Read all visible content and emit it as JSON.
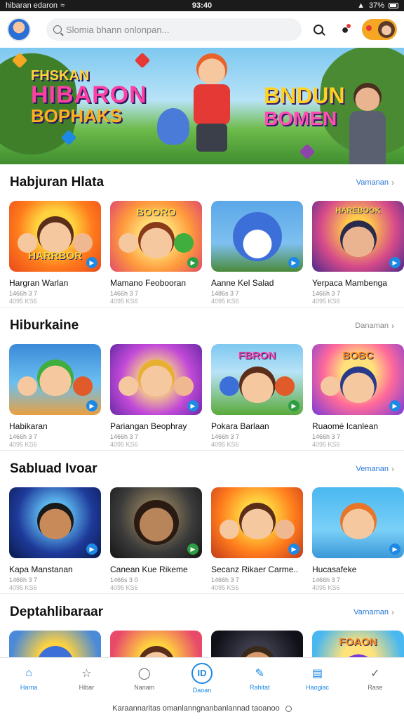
{
  "status_bar": {
    "carrier": "hibaran edaron",
    "time": "93:40",
    "battery": "37%"
  },
  "header": {
    "search_placeholder": "Slomia bhann onlonpan..."
  },
  "banner": {
    "left_line1": "FHSKAN",
    "left_line2": "HIBARON",
    "left_line3": "BOPHAKS",
    "right_line1": "BNDUN",
    "right_line2": "BOMEN"
  },
  "sections": [
    {
      "title": "Habjuran Hlata",
      "view_all": "Vamanan",
      "cards": [
        {
          "title": "Hargran Warlan",
          "meta1": "1466h 3 7",
          "meta2": "4095 KS6",
          "badge_color": "#1e88e5",
          "word": "HARRBOR"
        },
        {
          "title": "Mamano Feobooran",
          "meta1": "1466h 3 7",
          "meta2": "4095 KS6",
          "badge_color": "#1e88e5",
          "word": "BOORO"
        },
        {
          "title": "Aanne Kel Salad",
          "meta1": "1486s 3 7",
          "meta2": "4095 KS6",
          "badge_color": "#1e88e5",
          "word": ""
        },
        {
          "title": "Yerpaca Mambenga",
          "meta1": "1466h 3 7",
          "meta2": "4095 KS6",
          "badge_color": "#1e88e5",
          "word": "HAREBOOK"
        }
      ]
    },
    {
      "title": "Hiburkaine",
      "view_all": "Danaman",
      "cards": [
        {
          "title": "Habikaran",
          "meta1": "1466h 3 7",
          "meta2": "4095 KS6",
          "badge_color": "#1e88e5",
          "word": ""
        },
        {
          "title": "Pariangan Beophray",
          "meta1": "1466h 3 7",
          "meta2": "4095 KS6",
          "badge_color": "#1e88e5",
          "word": ""
        },
        {
          "title": "Pokara Barlaan",
          "meta1": "1466h 3 7",
          "meta2": "4095 KS6",
          "badge_color": "#1e88e5",
          "word": "FBRON"
        },
        {
          "title": "Ruaomé Icanlean",
          "meta1": "1466h 3 7",
          "meta2": "4095 KS6",
          "badge_color": "#1e88e5",
          "word": "BOBC"
        }
      ]
    },
    {
      "title": "Sabluad Ivoar",
      "view_all": "Vemanan",
      "cards": [
        {
          "title": "Kapa Manstanan",
          "meta1": "1466h 3 7",
          "meta2": "4095 KS6",
          "badge_color": "#1e88e5",
          "word": ""
        },
        {
          "title": "Canean Kue Rikeme",
          "meta1": "1466s 3 0",
          "meta2": "4095 KS6",
          "badge_color": "#2e9e44",
          "word": ""
        },
        {
          "title": "Secanz Rikaer Carme..",
          "meta1": "1466h 3 7",
          "meta2": "4095 KS6",
          "badge_color": "#1e88e5",
          "word": ""
        },
        {
          "title": "Hucasafeke",
          "meta1": "1466h 3 7",
          "meta2": "4095 KS6",
          "badge_color": "#1e88e5",
          "word": ""
        }
      ]
    },
    {
      "title": "Deptahlibaraar",
      "view_all": "Varnaman",
      "cards": [
        {
          "title": "",
          "meta1": "",
          "meta2": "",
          "badge_color": "#1e88e5",
          "word": ""
        },
        {
          "title": "",
          "meta1": "",
          "meta2": "",
          "badge_color": "#1e88e5",
          "word": ""
        },
        {
          "title": "",
          "meta1": "",
          "meta2": "",
          "badge_color": "#1e88e5",
          "word": ""
        },
        {
          "title": "",
          "meta1": "",
          "meta2": "",
          "badge_color": "#1e88e5",
          "word": "FOAON"
        }
      ]
    }
  ],
  "nav": [
    {
      "label": "Harna",
      "icon": "home-icon",
      "active": true
    },
    {
      "label": "Hibar",
      "icon": "star-icon",
      "active": false
    },
    {
      "label": "Nanam",
      "icon": "chat-icon",
      "active": false
    },
    {
      "label": "Daoan",
      "icon": "center-icon",
      "active": true,
      "center_text": "ID"
    },
    {
      "label": "Rahitat",
      "icon": "edit-icon",
      "active": true
    },
    {
      "label": "Haogiac",
      "icon": "book-icon",
      "active": true
    },
    {
      "label": "Rase",
      "icon": "check-icon",
      "active": false
    }
  ],
  "footer_text": "Karaannaritas omanlanngnanbanlannad taoanoo"
}
